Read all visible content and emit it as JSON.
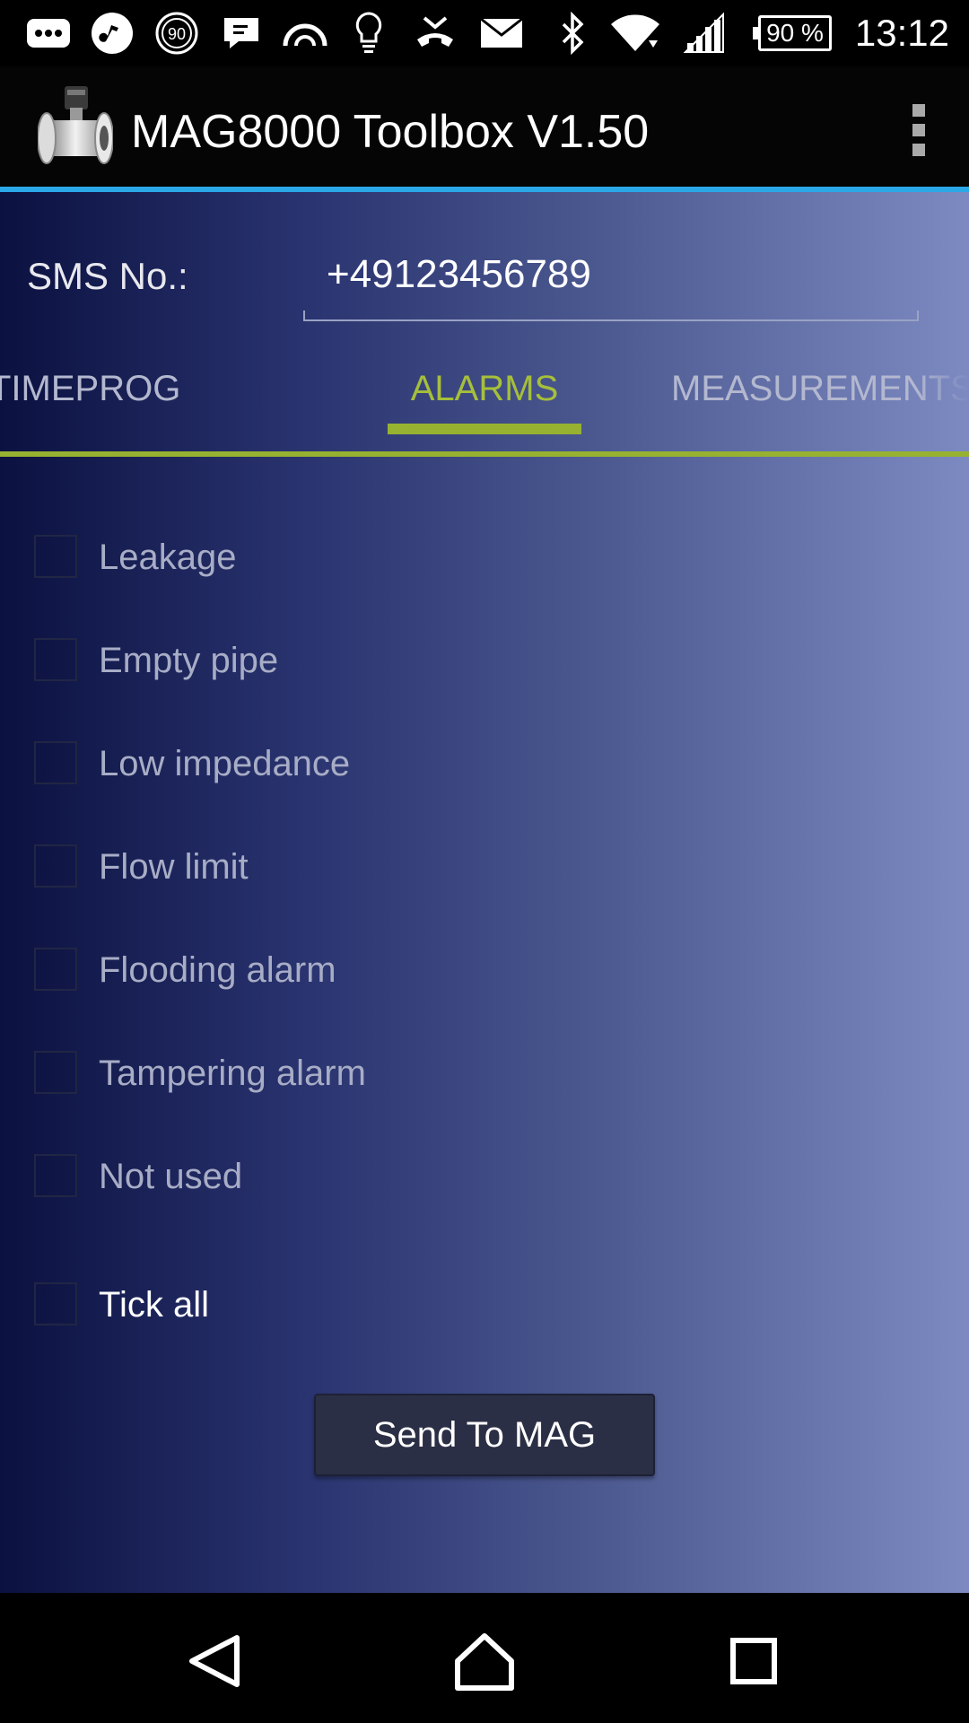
{
  "status_bar": {
    "battery": "90 %",
    "time": "13:12",
    "icons": [
      "messages-icon",
      "music-icon",
      "speed-90-icon",
      "chat-icon",
      "arc-icon",
      "lightbulb-icon",
      "missed-call-icon",
      "mail-icon",
      "bluetooth-icon",
      "wifi-icon",
      "signal-icon",
      "battery-icon"
    ],
    "badge_90": "90"
  },
  "app_bar": {
    "title": "MAG8000 Toolbox V1.50",
    "menu_icon": "overflow-menu-icon"
  },
  "sms": {
    "label": "SMS No.:",
    "value": "+49123456789"
  },
  "tabs": {
    "prev": "TIMEPROG",
    "active": "ALARMS",
    "next": "MEASUREMENTS"
  },
  "alarms": {
    "items": [
      {
        "label": "Leakage",
        "checked": false
      },
      {
        "label": "Empty pipe",
        "checked": false
      },
      {
        "label": "Low impedance",
        "checked": false
      },
      {
        "label": "Flow limit",
        "checked": false
      },
      {
        "label": "Flooding alarm",
        "checked": false
      },
      {
        "label": "Tampering alarm",
        "checked": false
      },
      {
        "label": "Not used",
        "checked": false
      }
    ],
    "tick_all": "Tick all"
  },
  "actions": {
    "send_label": "Send To MAG"
  },
  "nav": {
    "back": "back-icon",
    "home": "home-icon",
    "recents": "recents-icon"
  },
  "colors": {
    "accent_green": "#97b230",
    "app_bar_line": "#2aa8e8"
  }
}
